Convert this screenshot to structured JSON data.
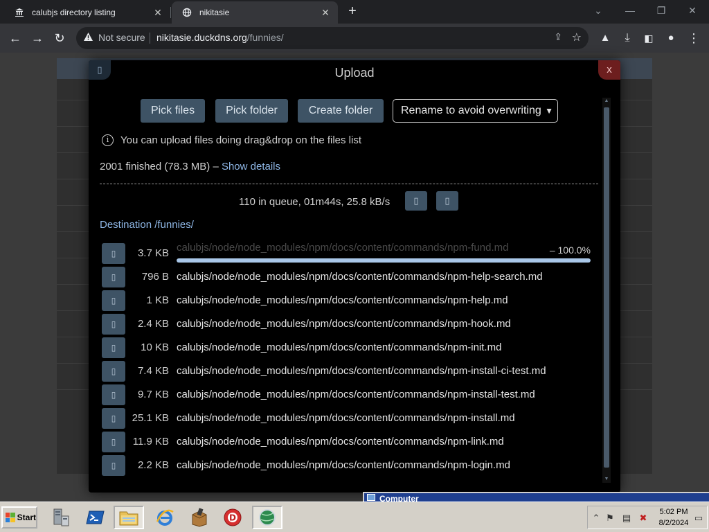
{
  "browser": {
    "tabs": [
      {
        "title": "calubjs directory listing",
        "icon": "bank-icon",
        "active": false
      },
      {
        "title": "nikitasie",
        "icon": "globe-icon",
        "active": true
      }
    ],
    "new_tab_symbol": "+",
    "address": {
      "security_text": "Not secure",
      "host": "nikitasie.duckdns.org",
      "path": "/funnies/"
    }
  },
  "modal": {
    "title": "Upload",
    "close_label": "x",
    "buttons": {
      "pick_files": "Pick files",
      "pick_folder": "Pick folder",
      "create_folder": "Create folder"
    },
    "overwrite_select": {
      "selected": "Rename to avoid overwriting"
    },
    "tip": "You can upload files doing drag&drop on the files list",
    "status": {
      "finished": "2001 finished (78.3 MB)",
      "separator": "–",
      "details_link": "Show details"
    },
    "queue": "110 in queue, 01m44s, 25.8 kB/s",
    "destination": "Destination /funnies/",
    "files": [
      {
        "size": "3.7 KB",
        "name": "calubjs/node/node_modules/npm/docs/content/commands/npm-fund.md",
        "progress_text": "– 100.0%",
        "progress": 1.0,
        "uploading": true
      },
      {
        "size": "796 B",
        "name": "calubjs/node/node_modules/npm/docs/content/commands/npm-help-search.md"
      },
      {
        "size": "1 KB",
        "name": "calubjs/node/node_modules/npm/docs/content/commands/npm-help.md"
      },
      {
        "size": "2.4 KB",
        "name": "calubjs/node/node_modules/npm/docs/content/commands/npm-hook.md"
      },
      {
        "size": "10 KB",
        "name": "calubjs/node/node_modules/npm/docs/content/commands/npm-init.md"
      },
      {
        "size": "7.4 KB",
        "name": "calubjs/node/node_modules/npm/docs/content/commands/npm-install-ci-test.md"
      },
      {
        "size": "9.7 KB",
        "name": "calubjs/node/node_modules/npm/docs/content/commands/npm-install-test.md"
      },
      {
        "size": "25.1 KB",
        "name": "calubjs/node/node_modules/npm/docs/content/commands/npm-install.md"
      },
      {
        "size": "11.9 KB",
        "name": "calubjs/node/node_modules/npm/docs/content/commands/npm-link.md"
      },
      {
        "size": "2.2 KB",
        "name": "calubjs/node/node_modules/npm/docs/content/commands/npm-login.md"
      }
    ]
  },
  "background_window": {
    "title": "Computer"
  },
  "taskbar": {
    "start_label": "Start",
    "clock": {
      "time": "5:02 PM",
      "date": "8/2/2024"
    }
  },
  "colors": {
    "accent_button": "#3e5365",
    "link": "#8fb7e6",
    "progress_fill": "#a9c7e8",
    "close_button": "#6d1e1e"
  }
}
